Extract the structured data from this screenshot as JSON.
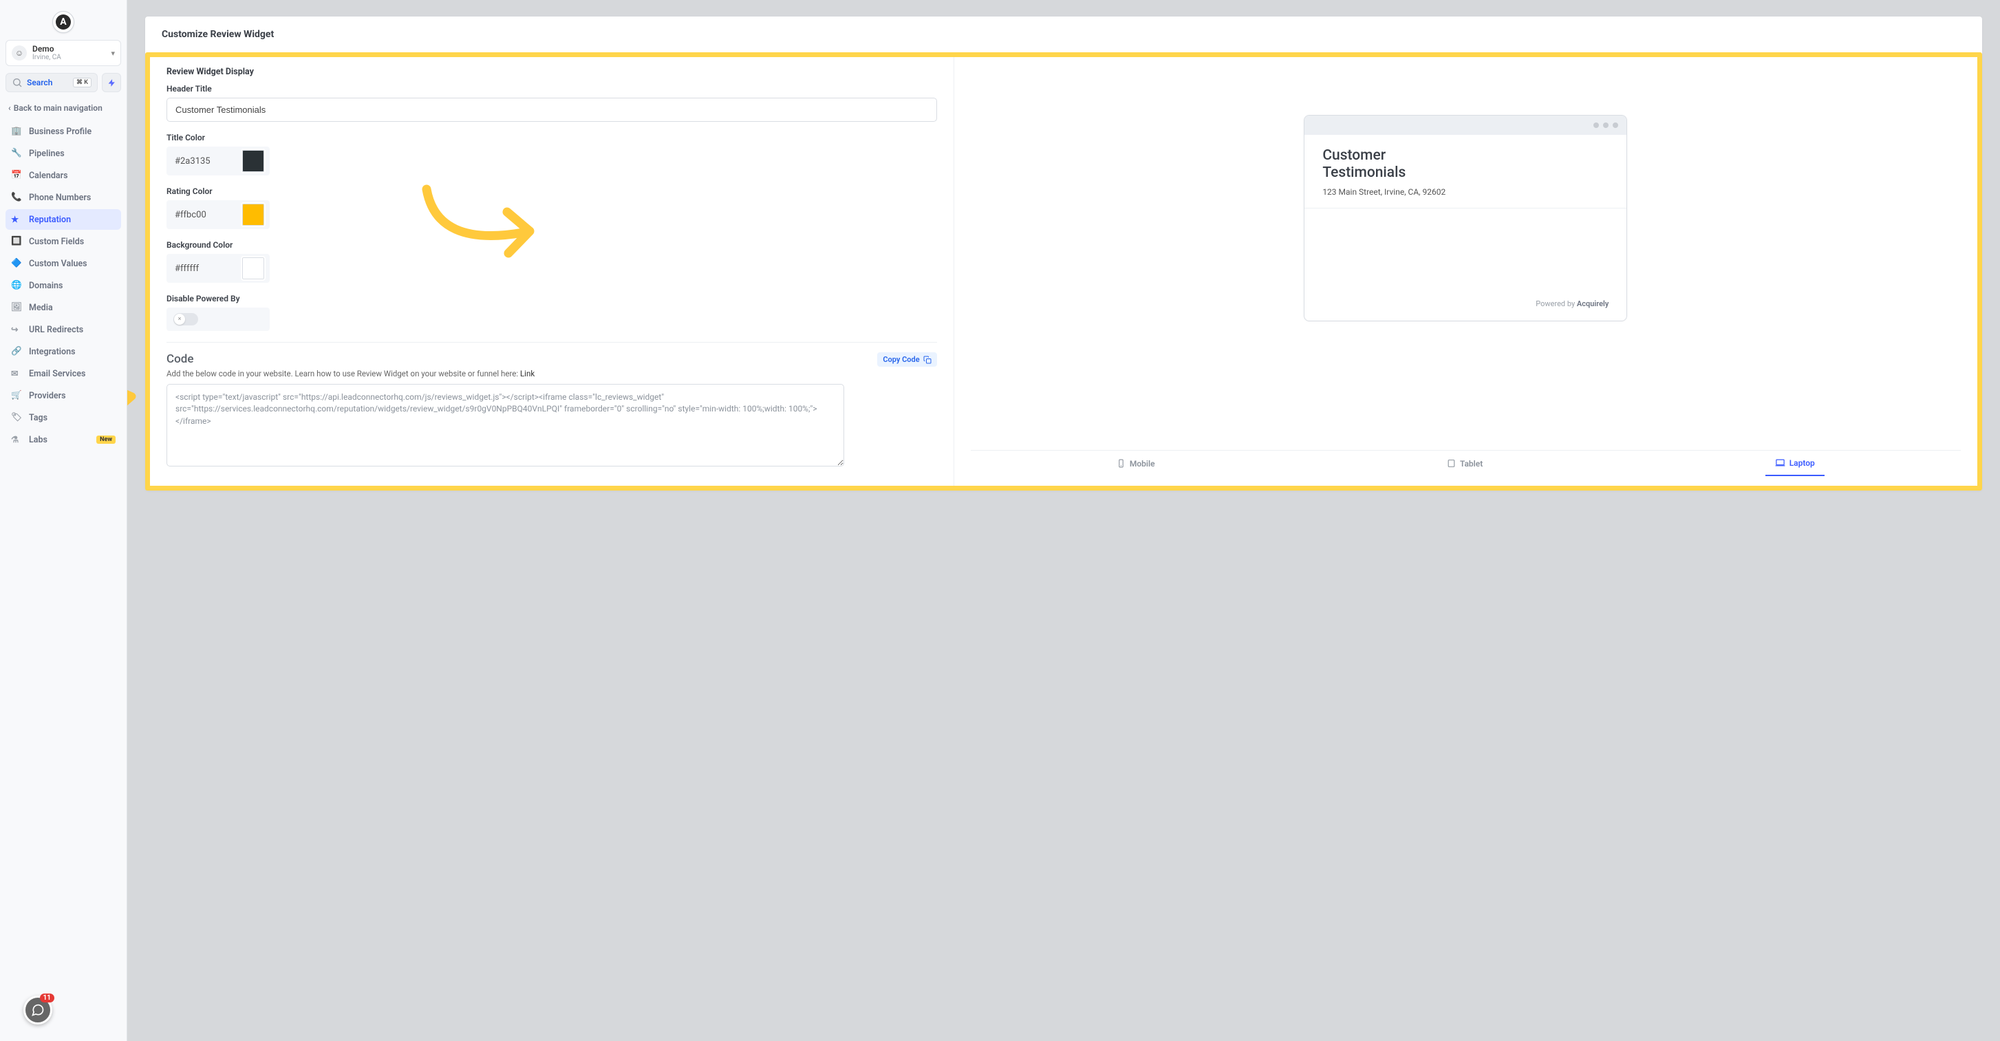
{
  "account": {
    "name": "Demo",
    "sub": "Irvine, CA"
  },
  "search": {
    "label": "Search",
    "shortcut": "⌘ K"
  },
  "back_link": "Back to main navigation",
  "nav": [
    {
      "label": "Business Profile"
    },
    {
      "label": "Pipelines"
    },
    {
      "label": "Calendars"
    },
    {
      "label": "Phone Numbers"
    },
    {
      "label": "Reputation",
      "active": true
    },
    {
      "label": "Custom Fields"
    },
    {
      "label": "Custom Values"
    },
    {
      "label": "Domains"
    },
    {
      "label": "Media"
    },
    {
      "label": "URL Redirects"
    },
    {
      "label": "Integrations"
    },
    {
      "label": "Email Services"
    },
    {
      "label": "Providers"
    },
    {
      "label": "Tags"
    },
    {
      "label": "Labs",
      "badge": "New"
    }
  ],
  "chat_badge": "11",
  "page_title": "Customize Review Widget",
  "form": {
    "section": "Review Widget Display",
    "header_title_label": "Header Title",
    "header_title_value": "Customer Testimonials",
    "title_color_label": "Title Color",
    "title_color_value": "#2a3135",
    "rating_color_label": "Rating Color",
    "rating_color_value": "#ffbc00",
    "bg_color_label": "Background Color",
    "bg_color_value": "#ffffff",
    "disable_label": "Disable Powered By",
    "code_heading": "Code",
    "code_desc": "Add the below code in your website. Learn how to use Review Widget on your website or funnel here: ",
    "code_link": "Link",
    "copy_label": "Copy Code",
    "code_value": "<script type=\"text/javascript\" src=\"https://api.leadconnectorhq.com/js/reviews_widget.js\"></script><iframe class=\"lc_reviews_widget\" src=\"https://services.leadconnectorhq.com/reputation/widgets/review_widget/s9r0gV0NpPBQ40VnLPQI\" frameborder=\"0\" scrolling=\"no\" style=\"min-width: 100%;width: 100%;\"></iframe>"
  },
  "preview": {
    "title": "Customer Testimonials",
    "address": "123 Main Street, Irvine, CA, 92602",
    "powered_prefix": "Powered by ",
    "powered_brand": "Acquirely"
  },
  "devices": {
    "mobile": "Mobile",
    "tablet": "Tablet",
    "laptop": "Laptop"
  }
}
